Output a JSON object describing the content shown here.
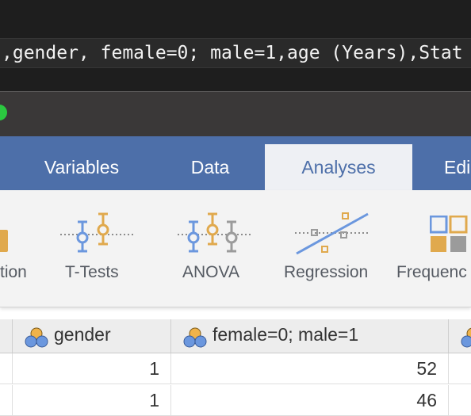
{
  "terminal": {
    "line": ",gender, female=0; male=1,age (Years),Stat"
  },
  "tabs": [
    {
      "label": "Variables",
      "active": false
    },
    {
      "label": "Data",
      "active": false
    },
    {
      "label": "Analyses",
      "active": true
    },
    {
      "label": "Edi",
      "active": false
    }
  ],
  "ribbon": {
    "items": [
      {
        "label": "tion",
        "icon": "exploration-icon"
      },
      {
        "label": "T-Tests",
        "icon": "t-tests-icon"
      },
      {
        "label": "ANOVA",
        "icon": "anova-icon"
      },
      {
        "label": "Regression",
        "icon": "regression-icon"
      },
      {
        "label": "Frequenc",
        "icon": "frequencies-icon"
      }
    ]
  },
  "grid": {
    "columns": [
      {
        "name": "",
        "icon": ""
      },
      {
        "name": "gender",
        "icon": "nominal-icon"
      },
      {
        "name": "female=0; male=1",
        "icon": "nominal-icon"
      },
      {
        "name": "",
        "icon": "nominal-icon"
      }
    ],
    "rows": [
      [
        "",
        "1",
        "52",
        ""
      ],
      [
        "",
        "1",
        "46",
        ""
      ]
    ]
  },
  "colors": {
    "tab_bar": "#4d6fa9",
    "active_tab": "#eef0f4",
    "blue_icon": "#6b97de",
    "gold_icon": "#e0a94d",
    "gray_icon": "#9b9b9b",
    "window_close_green": "#2bc840"
  }
}
